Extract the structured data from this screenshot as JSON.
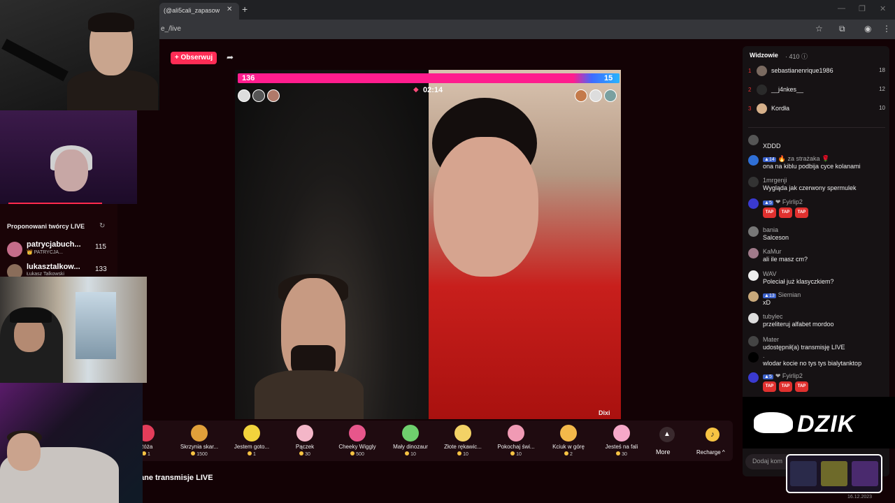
{
  "browser": {
    "tab_title": "(@ali5cali_zapasow",
    "tab_close": "✕",
    "new_tab": "+",
    "address": "e_/live",
    "win_min": "—",
    "win_max": "❐",
    "win_close": "✕"
  },
  "stream": {
    "follow_label": "+ Obserwuj",
    "share_icon": "➦",
    "pk_left_score": "136",
    "pk_right_score": "15",
    "timer": "02:14",
    "timer_icon": "◆",
    "guest_label": "Dixi"
  },
  "gifts": [
    {
      "name": "Róża",
      "price": "1",
      "color": "#e33d5a"
    },
    {
      "name": "Skrzynia skar...",
      "price": "1500",
      "color": "#e1a03a"
    },
    {
      "name": "Jestem goto...",
      "price": "1",
      "color": "#f2d33c"
    },
    {
      "name": "Pączek",
      "price": "30",
      "color": "#f4b6c8"
    },
    {
      "name": "Cheeky Wiggly",
      "price": "500",
      "color": "#e7568b"
    },
    {
      "name": "Mały dinozaur",
      "price": "10",
      "color": "#6fcf6d"
    },
    {
      "name": "Złote rękawic...",
      "price": "10",
      "color": "#f3d266"
    },
    {
      "name": "Pokochaj świ...",
      "price": "10",
      "color": "#f09ab4"
    },
    {
      "name": "Kciuk w górę",
      "price": "2",
      "color": "#f3b84a"
    },
    {
      "name": "Jesteś na fali",
      "price": "30",
      "color": "#f6a8c8"
    }
  ],
  "more_label": "More",
  "more_icon": "▲",
  "recharge_label": "Recharge ^",
  "recharge_icon": "♪",
  "bottom_title": "ane transmisje LIVE",
  "viewers": {
    "label": "Widzowie",
    "count": "· 410 ⓘ",
    "ranking": [
      {
        "rank": "1",
        "name": "sebastianenrique1986",
        "score": "18",
        "color": "#7a6a60"
      },
      {
        "rank": "2",
        "name": "__j4nkes__",
        "score": "12",
        "color": "#2a2a2a"
      },
      {
        "rank": "3",
        "name": "Kordła",
        "score": "10",
        "color": "#d6b08a"
      }
    ]
  },
  "chat": [
    {
      "user": "",
      "text": "XDDD",
      "color": "#555"
    },
    {
      "user": "🔥 za strażaka 🌹",
      "badge": "14",
      "text": "ona na kiblu podbija cyce kolanami",
      "color": "#2f6fd6"
    },
    {
      "user": "1mrgenji",
      "text": "Wygląda jak czerwony spermulek",
      "color": "#333"
    },
    {
      "user": "❤ Fyirlip2",
      "badge": "5",
      "text": "",
      "color": "#3a3ad0"
    },
    {
      "user": "bania",
      "text": "Salceson",
      "color": "#777"
    },
    {
      "user": "KaMur",
      "text": "ali ile masz cm?",
      "color": "#a07a8a"
    },
    {
      "user": "WAV",
      "text": "Poleciał już klasyczkiem?",
      "color": "#eee"
    },
    {
      "user": "Siemian",
      "badge": "13",
      "text": "xD",
      "color": "#c8a87a"
    },
    {
      "user": "tubylec",
      "text": "przeliteruj alfabet mordoo",
      "color": "#ddd"
    },
    {
      "user": "Mater",
      "text": "udostępnił(a) transmisję LIVE",
      "color": "#444"
    },
    {
      "user": ".",
      "text": "wlodar kocie no tys tys bialytanktop",
      "color": "#000"
    },
    {
      "user": "❤ Fyirlip2",
      "badge": "5",
      "text": "",
      "color": "#3a3ad0"
    }
  ],
  "tap_label": "TAP",
  "brand_overlay": "DZIK",
  "comment_placeholder": "Dodaj kom",
  "clock": "16.12.2023",
  "suggested": {
    "title": "Proponowani twórcy LIVE",
    "refresh": "↻",
    "creators": [
      {
        "name": "patrycjabuch...",
        "sub": "👑 PATRYCJA...",
        "count": "115",
        "color": "#c56d8a"
      },
      {
        "name": "lukasztalkow...",
        "sub": "Łukasz Talkowski",
        "count": "133",
        "color": "#8a6d5a"
      }
    ]
  },
  "colors": {
    "accent": "#fe2c55",
    "pk_pink": "#ff1d8e",
    "pk_blue": "#27b4ff",
    "gold": "#f6c343"
  }
}
